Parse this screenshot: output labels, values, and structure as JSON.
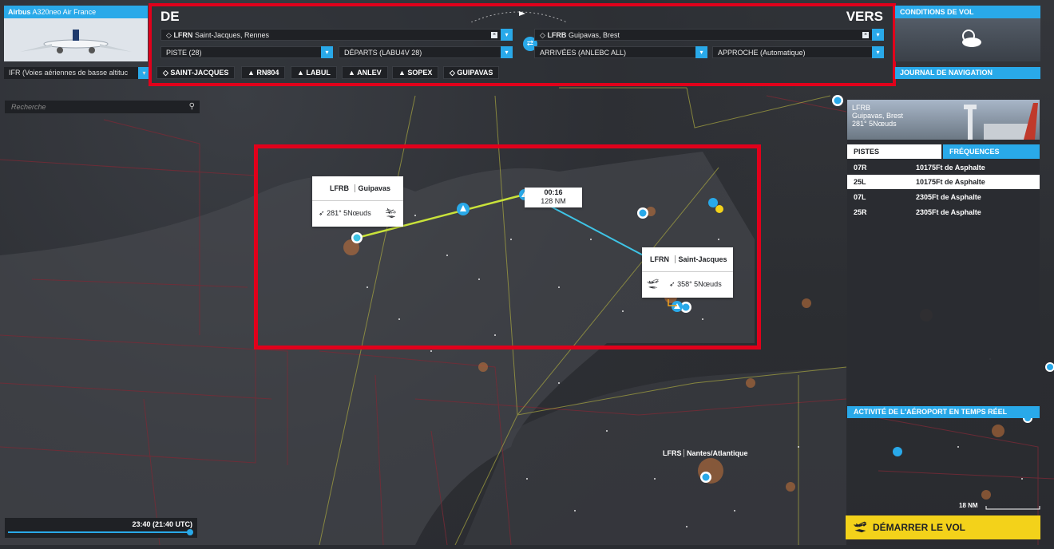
{
  "aircraft": {
    "brand": "Airbus",
    "model": "A320neo Air France"
  },
  "route": {
    "from_heading": "DE",
    "to_heading": "VERS",
    "departure": {
      "code": "LFRN",
      "name": "Saint-Jacques, Rennes"
    },
    "arrival": {
      "code": "LFRB",
      "name": "Guipavas, Brest"
    },
    "runway": "PISTE (28)",
    "departures": "DÉPARTS (LABU4V 28)",
    "arrivals": "ARRIVÉES (ANLEBC ALL)",
    "approach": "APPROCHE (Automatique)",
    "clear_mark": "×",
    "dropdown_mark": "▾",
    "swap_mark": "⇄"
  },
  "flight_type": "IFR (Voies aériennes de basse altituc",
  "waypoints": [
    {
      "type": "diamond",
      "label": "SAINT-JACQUES"
    },
    {
      "type": "triangle",
      "label": "RN804"
    },
    {
      "type": "triangle",
      "label": "LABUL"
    },
    {
      "type": "triangle",
      "label": "ANLEV"
    },
    {
      "type": "triangle",
      "label": "SOPEX"
    },
    {
      "type": "diamond",
      "label": "GUIPAVAS"
    }
  ],
  "weather_title": "CONDITIONS DE VOL",
  "navlog_title": "JOURNAL DE NAVIGATION",
  "search_placeholder": "Recherche",
  "map": {
    "leg_time": "00:16",
    "leg_distance": "128 NM",
    "dest_callout": {
      "code": "LFRB",
      "name": "Guipavas",
      "wind": "281° 5Nœuds"
    },
    "dep_callout": {
      "code": "LFRN",
      "name": "Saint-Jacques",
      "wind": "358° 5Nœuds"
    },
    "lfrs": {
      "code": "LFRS",
      "name": "Nantes/Atlantique"
    },
    "scale": "18 NM"
  },
  "airport": {
    "code": "LFRB",
    "name": "Guipavas, Brest",
    "wind": "281° 5Nœuds",
    "tab_runways": "PISTES",
    "tab_freq": "FRÉQUENCES",
    "runways": [
      {
        "id": "07R",
        "desc": "10175Ft de Asphalte"
      },
      {
        "id": "25L",
        "desc": "10175Ft de Asphalte"
      },
      {
        "id": "07L",
        "desc": "2305Ft de Asphalte"
      },
      {
        "id": "25R",
        "desc": "2305Ft de Asphalte"
      }
    ],
    "activity": "ACTIVITÉ DE L'AÉROPORT EN TEMPS RÉEL"
  },
  "time": "23:40 (21:40 UTC)",
  "start_button": "DÉMARRER LE VOL",
  "accent_color": "#29a9e9",
  "highlight_color": "#e1001b",
  "start_color": "#f3d21a"
}
